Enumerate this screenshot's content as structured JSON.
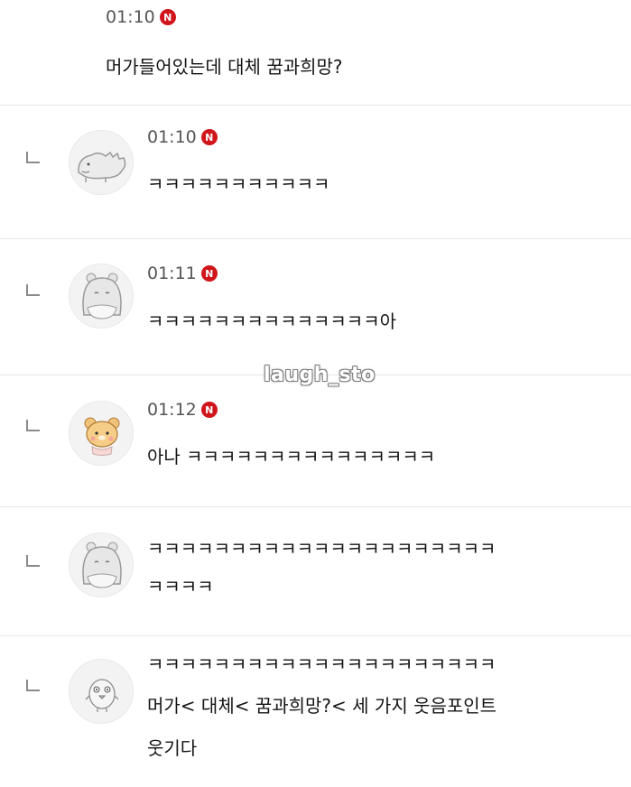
{
  "new_badge": "N",
  "watermark": "laugh_sto",
  "comments": [
    {
      "time": "01:10",
      "text": "머가들어있는데 대체 꿈과희망?"
    },
    {
      "time": "01:10",
      "text": "ㅋㅋㅋㅋㅋㅋㅋㅋㅋㅋㅋ",
      "avatar": "dinosaur-avatar-icon"
    },
    {
      "time": "01:11",
      "text": "ㅋㅋㅋㅋㅋㅋㅋㅋㅋㅋㅋㅋㅋㅋ아",
      "avatar": "hamster-avatar-icon"
    },
    {
      "time": "01:12",
      "text": "아나 ㅋㅋㅋㅋㅋㅋㅋㅋㅋㅋㅋㅋㅋㅋㅋ",
      "avatar": "bear-avatar-icon"
    },
    {
      "lines": [
        "ㅋㅋㅋㅋㅋㅋㅋㅋㅋㅋㅋㅋㅋㅋㅋㅋㅋㅋㅋㅋㅋ",
        "ㅋㅋㅋㅋ"
      ],
      "avatar": "hamster-avatar-icon"
    },
    {
      "lines": [
        "ㅋㅋㅋㅋㅋㅋㅋㅋㅋㅋㅋㅋㅋㅋㅋㅋㅋㅋㅋㅋㅋ",
        "머가< 대체< 꿈과희망?< 세 가지 웃음포인트",
        "웃기다"
      ],
      "avatar": "chick-avatar-icon"
    }
  ],
  "colors": {
    "badge": "#d0161b",
    "separator": "#e6e6e6",
    "time": "#555555"
  }
}
